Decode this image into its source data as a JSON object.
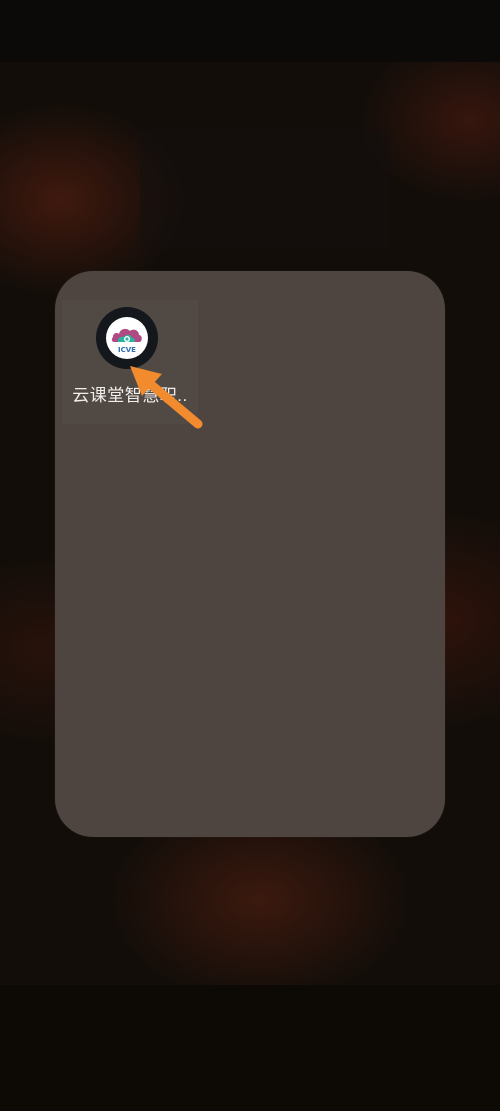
{
  "home_folder": {
    "apps": [
      {
        "label": "云课堂智慧职..",
        "icon": "icve-cloud-logo-icon",
        "logo_text": "ICVE"
      }
    ]
  },
  "annotation": {
    "icon": "orange-pointer-arrow-icon",
    "color": "#f28a2e"
  },
  "colors": {
    "folder_background": "#4e4540",
    "wallpaper": "#120d09",
    "logo_cloud_pink": "#b04a82",
    "logo_cloud_teal": "#2bb3a0"
  }
}
